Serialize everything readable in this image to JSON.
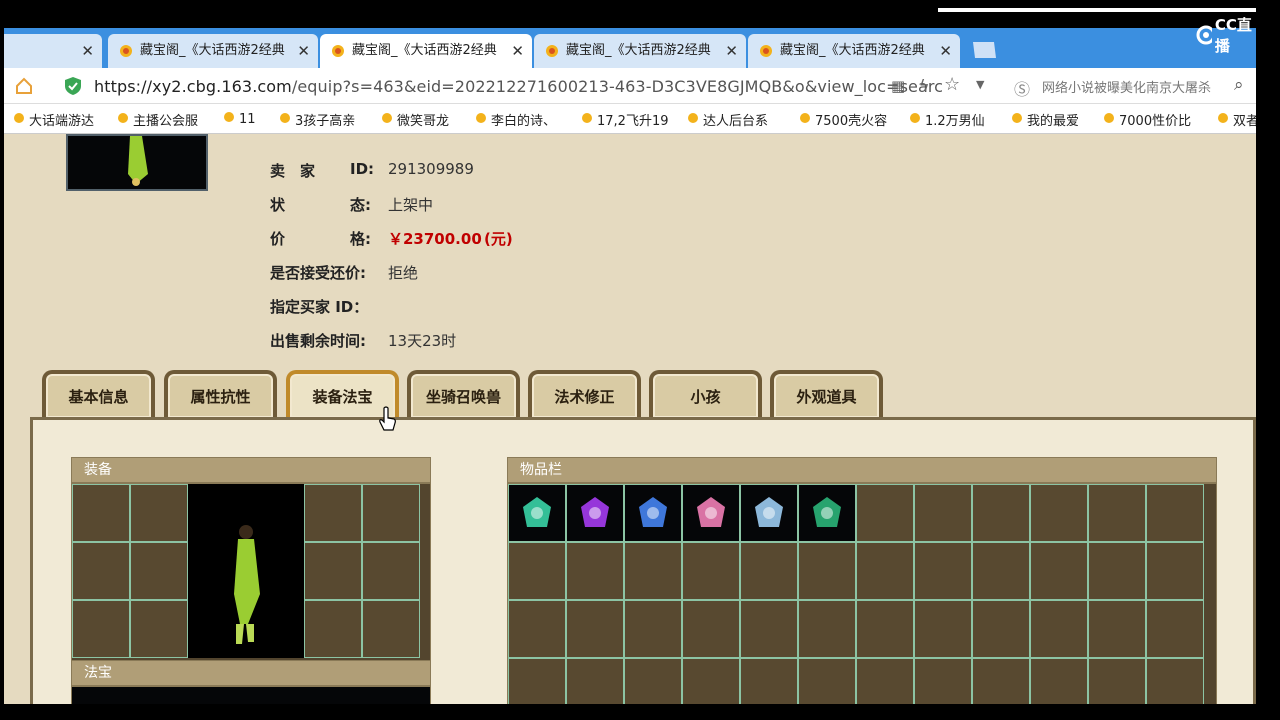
{
  "browser": {
    "tabs": [
      {
        "title": "藏宝阁_《大话西游2经典",
        "active": false
      },
      {
        "title": "藏宝阁_《大话西游2经典",
        "active": true
      },
      {
        "title": "藏宝阁_《大话西游2经典",
        "active": false
      },
      {
        "title": "藏宝阁_《大话西游2经典",
        "active": false
      }
    ],
    "url_host": "https://xy2.cbg.163.com",
    "url_rest": "/equip?s=463&eid=202212271600213-463-D3C3VE8GJMQB&o&view_loc=searc",
    "search_text": "网络小说被曝美化南京大屠杀",
    "cc_logo": "CC直播"
  },
  "bookmarks": [
    "大话端游达",
    "主播公会服",
    "11",
    "3孩子高亲",
    "微笑哥龙",
    "李白的诗、",
    "17,2飞升19",
    "达人后台系",
    "7500壳火容",
    "1.2万男仙",
    "我的最爱",
    "7000性价比",
    "双者"
  ],
  "info": {
    "seller_label": "卖　家",
    "id_label": "ID:",
    "seller_id": "291309989",
    "status_label_1": "状",
    "status_label_2": "态:",
    "status_value": "上架中",
    "price_label_1": "价",
    "price_label_2": "格:",
    "price_value": "￥23700.00",
    "price_unit": "(元)",
    "counter_label": "是否接受还价:",
    "counter_value": "拒绝",
    "buyer_label": "指定买家 ID：",
    "time_label": "出售剩余时间:",
    "time_value": "13天23时"
  },
  "game_tabs": [
    "基本信息",
    "属性抗性",
    "装备法宝",
    "坐骑召唤兽",
    "法术修正",
    "小孩",
    "外观道具"
  ],
  "active_game_tab": 2,
  "sections": {
    "equipment": "装备",
    "treasure": "法宝",
    "inventory": "物品栏"
  },
  "inventory_items": [
    "green-gem-icon",
    "purple-gem-icon",
    "blue-crystal-icon",
    "pink-heart-icon",
    "ice-cube-icon",
    "green-orb-icon"
  ],
  "colors": {
    "price": "#c00000",
    "tabbar": "#3b8fe0",
    "grid_line": "#8cc4a4"
  }
}
